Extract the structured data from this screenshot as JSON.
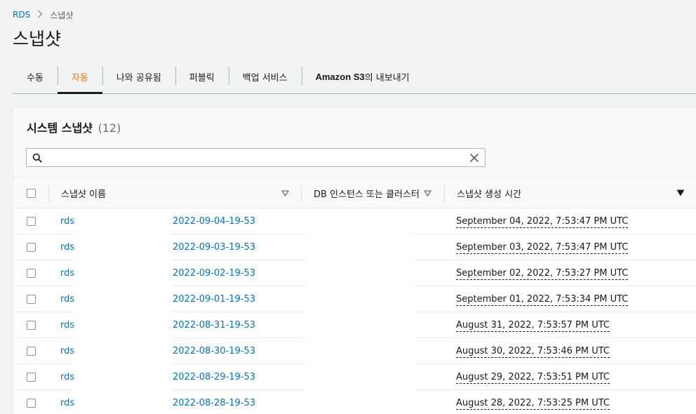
{
  "breadcrumb": {
    "root": "RDS",
    "current": "스냅샷"
  },
  "page": {
    "title": "스냅샷"
  },
  "tabs": [
    {
      "label": "수동",
      "active": false
    },
    {
      "label": "자동",
      "active": true
    },
    {
      "label": "나와 공유됨",
      "active": false
    },
    {
      "label": "퍼블릭",
      "active": false
    },
    {
      "label": "백업 서비스",
      "active": false
    },
    {
      "label_prefix": "Amazon S3",
      "label_suffix": "의 내보내기",
      "active": false
    }
  ],
  "panel": {
    "title": "시스템 스냅샷",
    "count": "(12)"
  },
  "search": {
    "value": "",
    "placeholder": ""
  },
  "table": {
    "columns": {
      "name": "스냅샷 이름",
      "instance": "DB 인스턴스 또는 클러스터",
      "created": "스냅샷 생성 시간"
    },
    "rows": [
      {
        "prefix": "rds",
        "snapshot_date": "2022-09-04-19-53",
        "created": "September 04, 2022, 7:53:47 PM UTC"
      },
      {
        "prefix": "rds",
        "snapshot_date": "2022-09-03-19-53",
        "created": "September 03, 2022, 7:53:47 PM UTC"
      },
      {
        "prefix": "rds",
        "snapshot_date": "2022-09-02-19-53",
        "created": "September 02, 2022, 7:53:27 PM UTC"
      },
      {
        "prefix": "rds",
        "snapshot_date": "2022-09-01-19-53",
        "created": "September 01, 2022, 7:53:34 PM UTC"
      },
      {
        "prefix": "rds",
        "snapshot_date": "2022-08-31-19-53",
        "created": "August 31, 2022, 7:53:57 PM UTC"
      },
      {
        "prefix": "rds",
        "snapshot_date": "2022-08-30-19-53",
        "created": "August 30, 2022, 7:53:46 PM UTC"
      },
      {
        "prefix": "rds",
        "snapshot_date": "2022-08-29-19-53",
        "created": "August 29, 2022, 7:53:51 PM UTC"
      },
      {
        "prefix": "rds",
        "snapshot_date": "2022-08-28-19-53",
        "created": "August 28, 2022, 7:53:25 PM UTC"
      }
    ]
  },
  "icons": {
    "breadcrumb_separator": "chevron-right-icon",
    "search": "search-icon",
    "clear": "close-icon",
    "sort_unsorted": "caret-down-outline-icon",
    "sort_active": "caret-down-solid-icon"
  },
  "colors": {
    "link": "#0073bb",
    "active_tab": "#ec7211",
    "text": "#16191f",
    "muted": "#687078",
    "background": "#f2f3f3"
  }
}
